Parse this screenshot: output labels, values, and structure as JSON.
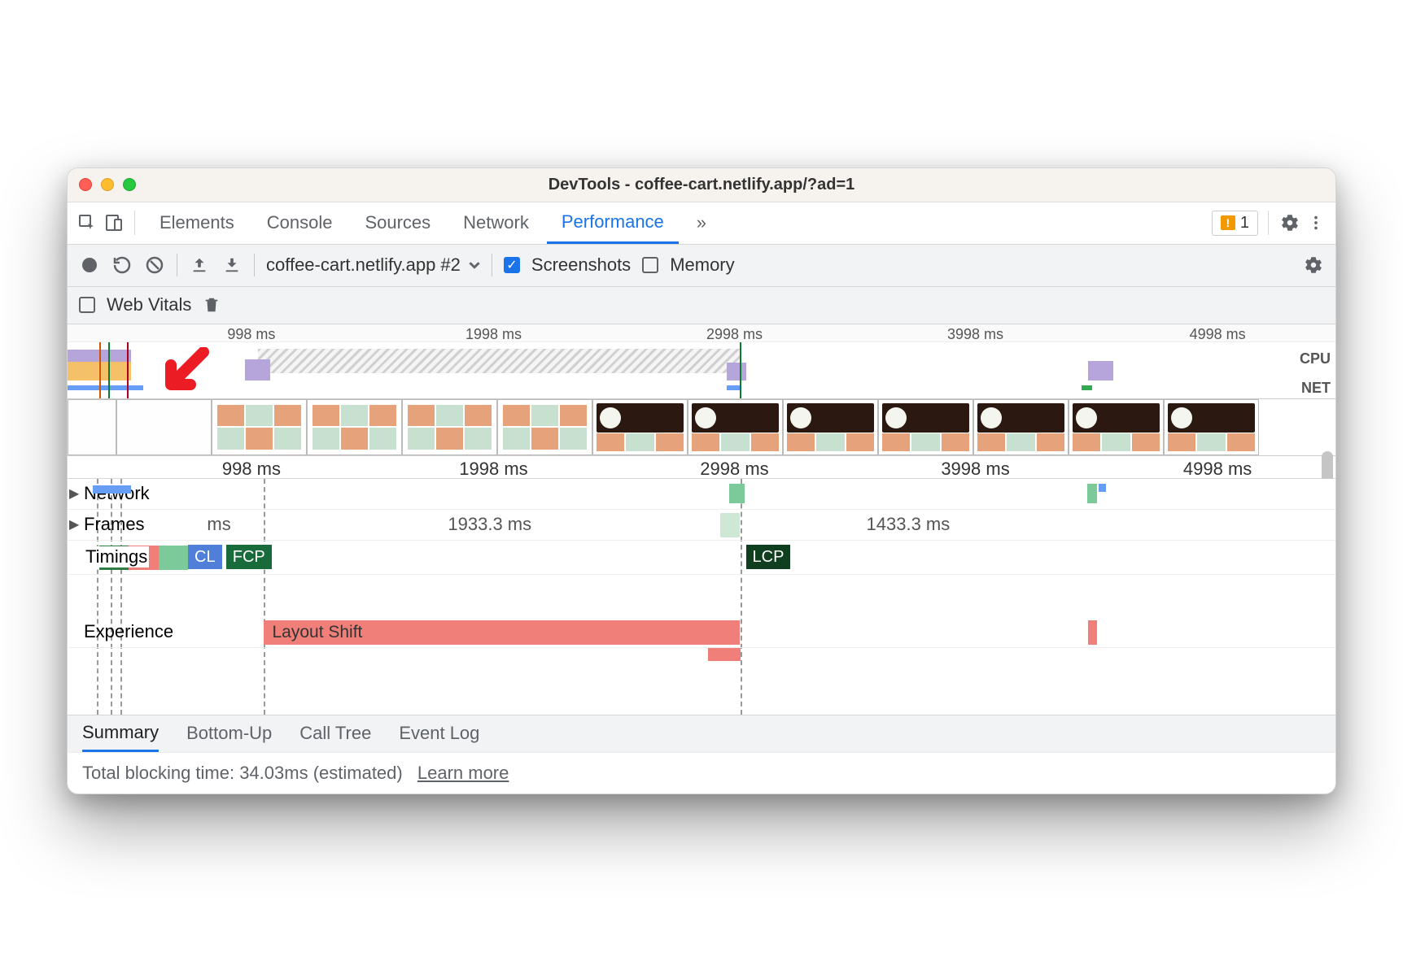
{
  "window": {
    "title": "DevTools - coffee-cart.netlify.app/?ad=1"
  },
  "tabs": {
    "elements": "Elements",
    "console": "Console",
    "sources": "Sources",
    "network": "Network",
    "performance": "Performance",
    "more_glyph": "»",
    "issues_count": "1"
  },
  "toolbar": {
    "recording_select": "coffee-cart.netlify.app #2",
    "screenshots_label": "Screenshots",
    "memory_label": "Memory"
  },
  "toolbar2": {
    "web_vitals": "Web Vitals"
  },
  "overview": {
    "ticks": [
      "998 ms",
      "1998 ms",
      "2998 ms",
      "3998 ms",
      "4998 ms"
    ],
    "cpu_label": "CPU",
    "net_label": "NET"
  },
  "ruler2": {
    "ticks": [
      "998 ms",
      "1998 ms",
      "2998 ms",
      "3998 ms",
      "4998 ms"
    ]
  },
  "tracks": {
    "network": "Network",
    "frames": "Frames",
    "frames_ms_a": "ms",
    "frames_ms_b": "1933.3 ms",
    "frames_ms_c": "1433.3 ms",
    "timings": "Timings",
    "timings_cl": "CL",
    "timings_fcp": "FCP",
    "timings_lcp": "LCP",
    "experience": "Experience",
    "layout_shift": "Layout Shift"
  },
  "bottom": {
    "summary": "Summary",
    "bottom_up": "Bottom-Up",
    "call_tree": "Call Tree",
    "event_log": "Event Log",
    "total_blocking": "Total blocking time: 34.03ms (estimated)",
    "learn_more": "Learn more"
  }
}
